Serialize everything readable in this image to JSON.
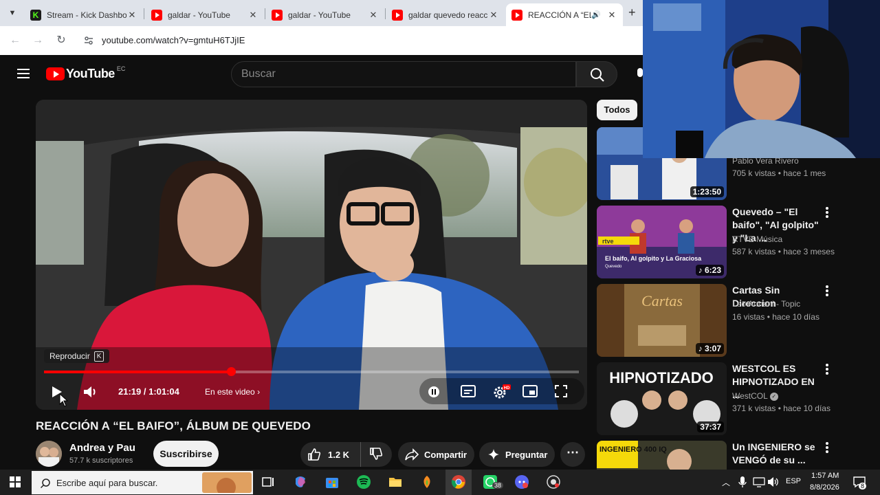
{
  "browser": {
    "tabs": [
      {
        "label": "Stream - Kick Dashboard",
        "favicon": "kick-icon"
      },
      {
        "label": "galdar - YouTube",
        "favicon": "youtube-icon"
      },
      {
        "label": "galdar - YouTube",
        "favicon": "youtube-icon"
      },
      {
        "label": "galdar quevedo reacción",
        "favicon": "youtube-icon"
      },
      {
        "label": "REACCIÓN A “EL BAIFO”",
        "favicon": "youtube-icon",
        "active": true
      }
    ],
    "url": "youtube.com/watch?v=gmtuH6TJjIE"
  },
  "header": {
    "logo_text": "YouTube",
    "country_code": "EC",
    "search_placeholder": "Buscar"
  },
  "player": {
    "tooltip": "Reproducir",
    "tooltip_key": "K",
    "time": "21:19 / 1:01:04",
    "chapter": "En este video",
    "progress_fraction": 0.349
  },
  "video": {
    "title": "REACCIÓN A “EL BAIFO”, ÁLBUM DE QUEVEDO",
    "channel": "Andrea y Pau",
    "subscribers": "57.7 k suscriptores",
    "subscribe_label": "Suscribirse",
    "likes": "1.2 K",
    "share_label": "Compartir",
    "ask_label": "Preguntar"
  },
  "sidebar": {
    "chip": "Todos",
    "recs": [
      {
        "title": "",
        "channel": "Pablo Vera Rivero",
        "meta": "705 k vistas • hace 1 mes",
        "duration": "1:23:50"
      },
      {
        "title": "Quevedo – \"El baifo\", \"Al golpito\" y \"La ...",
        "channel": "RTVE Música",
        "meta": "587 k vistas • hace 3 meses",
        "duration": "6:23",
        "thumb_caption": "El baifo, Al golpito y La Graciosa",
        "thumb_sub": "Quevedo",
        "thumb_brand": "rtve"
      },
      {
        "title": "Cartas Sin Direccion",
        "channel": "Leo Armani - Topic",
        "meta": "16 vistas • hace 10 días",
        "duration": "3:07",
        "thumb_caption": "Cartas"
      },
      {
        "title": "WESTCOL ES HIPNOTIZADO EN ...",
        "channel": "WestCOL",
        "meta": "371 k vistas • hace 10 días",
        "duration": "37:37",
        "thumb_caption": "HIPNOTIZADO"
      },
      {
        "title": "Un INGENIERO se VENGÓ de su ...",
        "channel": "",
        "meta": "",
        "duration": "",
        "thumb_caption": "INGENIERO 400 IQ"
      }
    ]
  },
  "taskbar": {
    "search_placeholder": "Escribe aquí para buscar.",
    "whatsapp_badge": "38",
    "language": "ESP",
    "time": "1:57 AM",
    "date": "8/8/2026",
    "notifications": "8"
  },
  "colors": {
    "accent_red": "#ff0000",
    "background": "#0f0f0f",
    "chip_bg": "#f1f1f1"
  }
}
